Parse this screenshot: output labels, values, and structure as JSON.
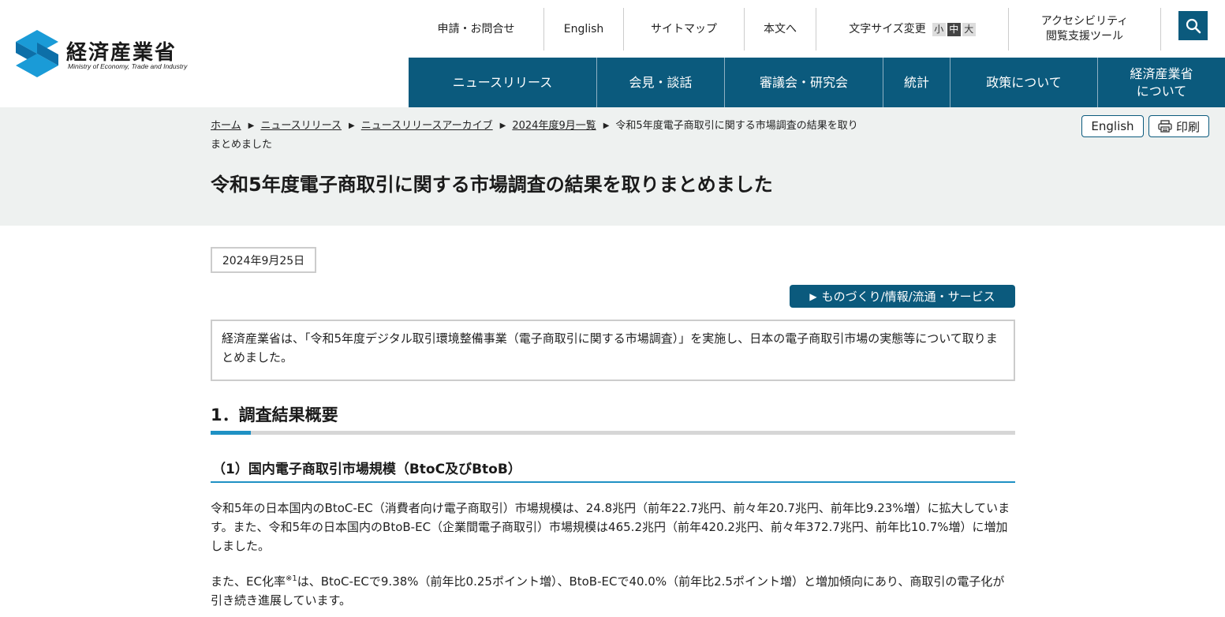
{
  "header": {
    "logo_jp": "経済産業省",
    "logo_en": "Ministry of Economy, Trade and Industry",
    "util": {
      "contact": "申請・お問合せ",
      "english": "English",
      "sitemap": "サイトマップ",
      "skip": "本文へ",
      "font_size_label": "文字サイズ変更",
      "size_small": "小",
      "size_medium": "中",
      "size_large": "大",
      "accessibility_line1": "アクセシビリティ",
      "accessibility_line2": "閲覧支援ツール"
    },
    "search_icon": "search-icon",
    "nav": {
      "news": "ニュースリリース",
      "press": "会見・談話",
      "council": "審議会・研究会",
      "stats": "統計",
      "policy": "政策について",
      "about_line1": "経済産業省",
      "about_line2": "について"
    }
  },
  "breadcrumb": {
    "home": "ホーム",
    "news": "ニュースリリース",
    "archive": "ニュースリリースアーカイブ",
    "month": "2024年度9月一覧",
    "current": "令和5年度電子商取引に関する市場調査の結果を取りまとめました"
  },
  "tools": {
    "english": "English",
    "print": "印刷",
    "print_icon": "printer-icon"
  },
  "page": {
    "title": "令和5年度電子商取引に関する市場調査の結果を取りまとめました",
    "date": "2024年9月25日",
    "category": "ものづくり/情報/流通・サービス",
    "lead": "経済産業省は、「令和5年度デジタル取引環境整備事業（電子商取引に関する市場調査）」を実施し、日本の電子商取引市場の実態等について取りまとめました。",
    "h2": "1．調査結果概要",
    "h3": "（1）国内電子商取引市場規模（BtoC及びBtoB）",
    "para1": "令和5年の日本国内のBtoC-EC（消費者向け電子商取引）市場規模は、24.8兆円（前年22.7兆円、前々年20.7兆円、前年比9.23%増）に拡大しています。また、令和5年の日本国内のBtoB-EC（企業間電子商取引）市場規模は465.2兆円（前年420.2兆円、前々年372.7兆円、前年比10.7%増）に増加しました。",
    "para2_before": "また、EC化率",
    "para2_sup": "※1",
    "para2_after": "は、BtoC-ECで9.38%（前年比0.25ポイント増）、BtoB-ECで40.0%（前年比2.5ポイント増）と増加傾向にあり、商取引の電子化が引き続き進展しています。"
  },
  "colors": {
    "brand": "#0b5a7d",
    "accent": "#1f91c4",
    "band": "#eef1f0",
    "logo": "#1a9bd7"
  }
}
